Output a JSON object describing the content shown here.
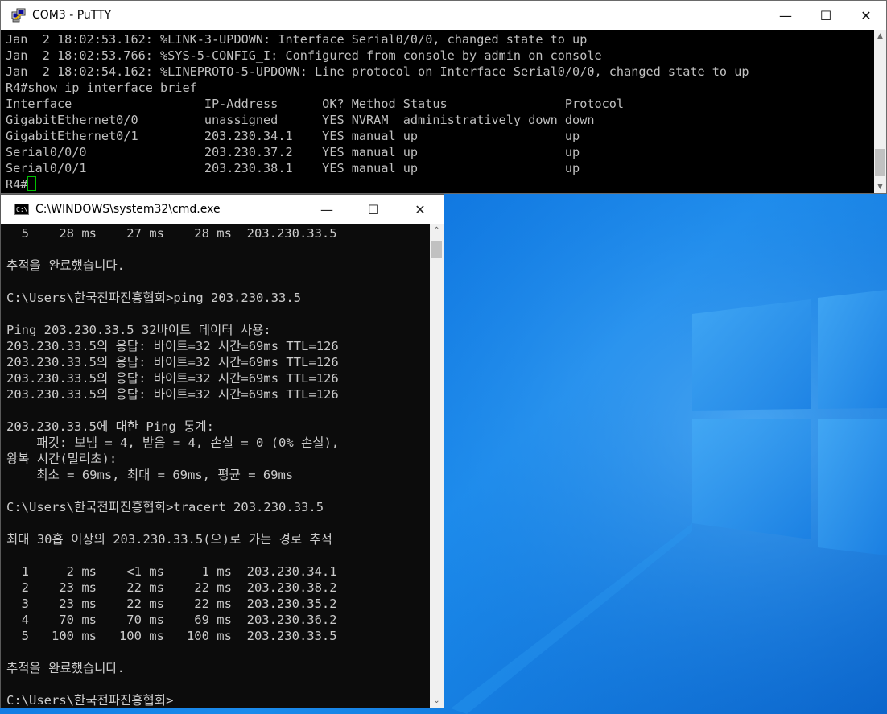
{
  "putty": {
    "title": "COM3 - PuTTY",
    "lines": [
      "Jan  2 18:02:53.162: %LINK-3-UPDOWN: Interface Serial0/0/0, changed state to up",
      "Jan  2 18:02:53.766: %SYS-5-CONFIG_I: Configured from console by admin on console",
      "Jan  2 18:02:54.162: %LINEPROTO-5-UPDOWN: Line protocol on Interface Serial0/0/0, changed state to up",
      "R4#show ip interface brief",
      "Interface                  IP-Address      OK? Method Status                Protocol",
      "GigabitEthernet0/0         unassigned      YES NVRAM  administratively down down",
      "GigabitEthernet0/1         203.230.34.1    YES manual up                    up",
      "Serial0/0/0                203.230.37.2    YES manual up                    up",
      "Serial0/0/1                203.230.38.1    YES manual up                    up"
    ],
    "prompt": "R4#",
    "cursor_color": "#00c000"
  },
  "cmd": {
    "title": "C:\\WINDOWS\\system32\\cmd.exe",
    "lines": [
      "  5    28 ms    27 ms    28 ms  203.230.33.5",
      "",
      "추적을 완료했습니다.",
      "",
      "C:\\Users\\한국전파진흥협회>ping 203.230.33.5",
      "",
      "Ping 203.230.33.5 32바이트 데이터 사용:",
      "203.230.33.5의 응답: 바이트=32 시간=69ms TTL=126",
      "203.230.33.5의 응답: 바이트=32 시간=69ms TTL=126",
      "203.230.33.5의 응답: 바이트=32 시간=69ms TTL=126",
      "203.230.33.5의 응답: 바이트=32 시간=69ms TTL=126",
      "",
      "203.230.33.5에 대한 Ping 통계:",
      "    패킷: 보냄 = 4, 받음 = 4, 손실 = 0 (0% 손실),",
      "왕복 시간(밀리초):",
      "    최소 = 69ms, 최대 = 69ms, 평균 = 69ms",
      "",
      "C:\\Users\\한국전파진흥협회>tracert 203.230.33.5",
      "",
      "최대 30홉 이상의 203.230.33.5(으)로 가는 경로 추적",
      "",
      "  1     2 ms    <1 ms     1 ms  203.230.34.1",
      "  2    23 ms    22 ms    22 ms  203.230.38.2",
      "  3    23 ms    22 ms    22 ms  203.230.35.2",
      "  4    70 ms    70 ms    69 ms  203.230.36.2",
      "  5   100 ms   100 ms   100 ms  203.230.33.5",
      "",
      "추적을 완료했습니다.",
      "",
      "C:\\Users\\한국전파진흥협회>"
    ]
  },
  "window_buttons": {
    "minimize": "—",
    "maximize": "☐",
    "close": "✕"
  },
  "colors": {
    "putty_text": "#c0c0c0",
    "cmd_text": "#cccccc",
    "desktop": "#0f74de"
  }
}
